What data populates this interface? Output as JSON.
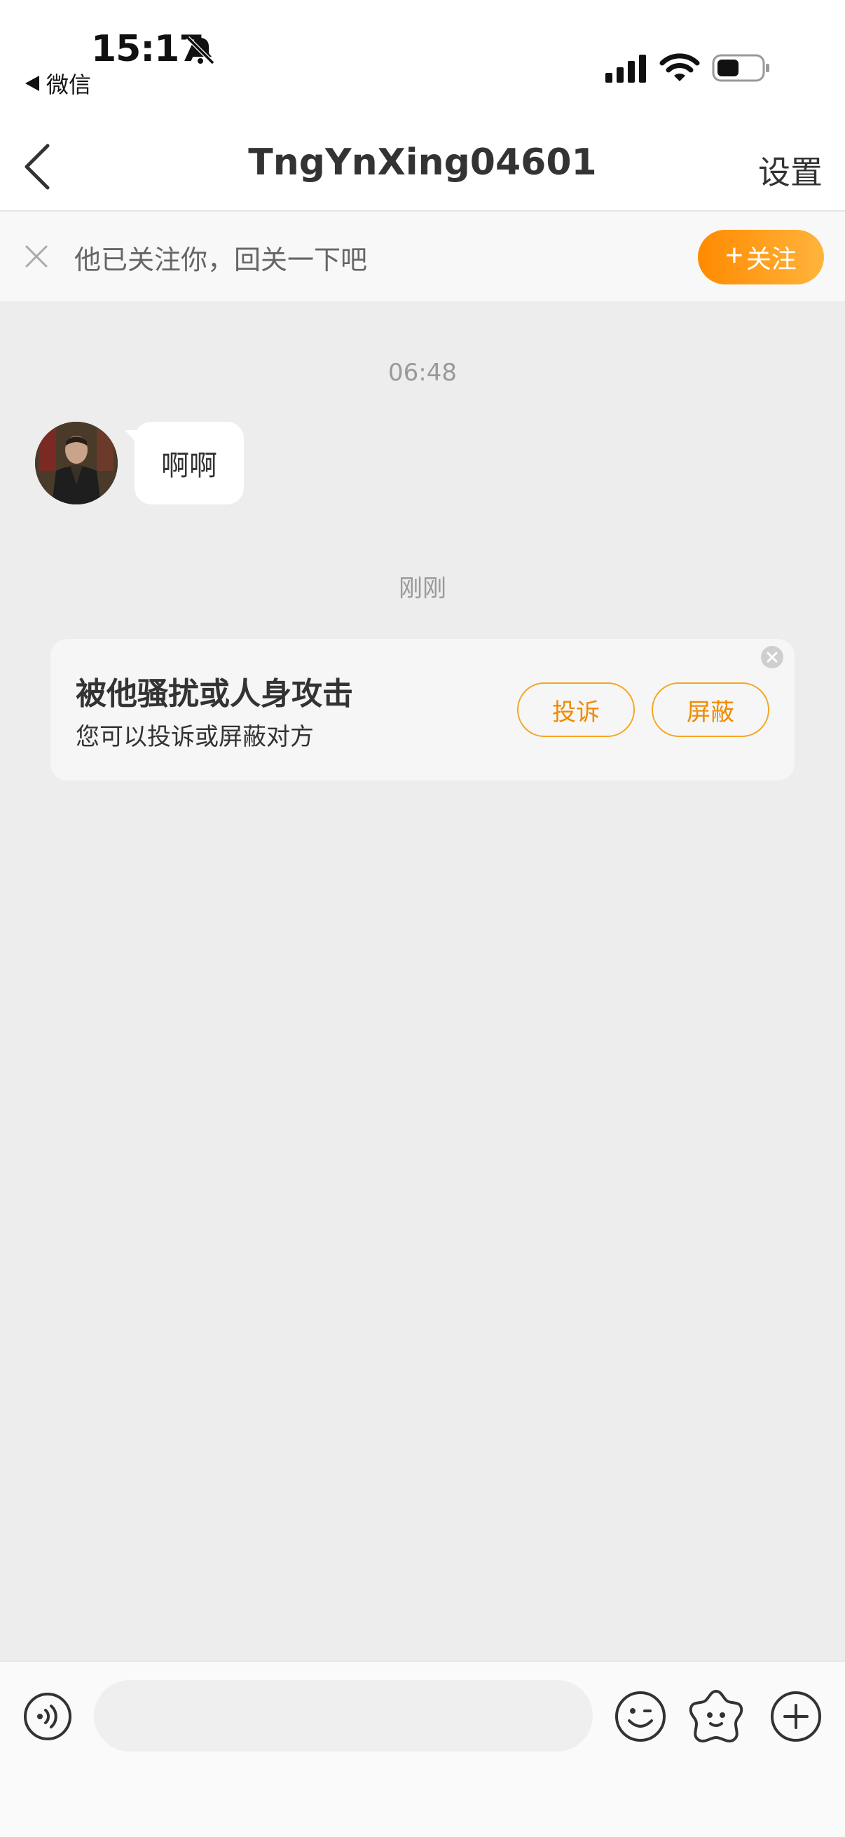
{
  "status_bar": {
    "time": "15:17",
    "back_app_label": "微信"
  },
  "nav": {
    "title": "TngYnXing04601",
    "settings_label": "设置"
  },
  "follow_banner": {
    "text": "他已关注你，回关一下吧",
    "follow_plus": "+",
    "follow_label": "关注"
  },
  "chat": {
    "messages": [
      {
        "time": "06:48",
        "text": "啊啊"
      }
    ],
    "notice_time": "刚刚"
  },
  "report_card": {
    "title": "被他骚扰或人身攻击",
    "subtitle": "您可以投诉或屏蔽对方",
    "report_label": "投诉",
    "block_label": "屏蔽"
  },
  "input_bar": {
    "placeholder": ""
  },
  "colors": {
    "accent_orange": "#ff8a00",
    "chat_background": "#ededed",
    "bubble_background": "#ffffff"
  }
}
